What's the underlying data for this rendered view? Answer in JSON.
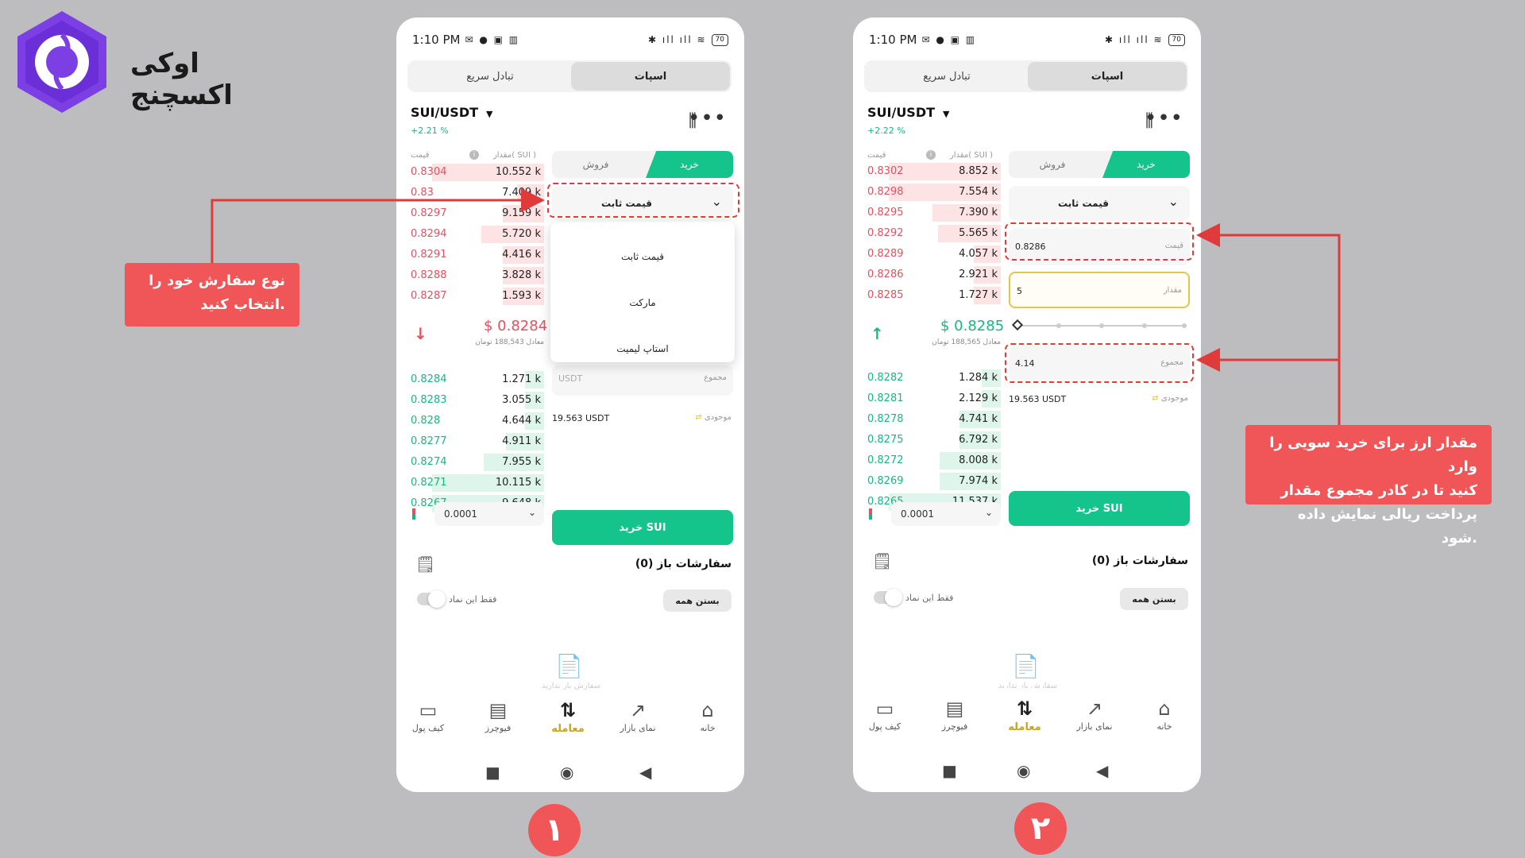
{
  "brand": {
    "name": "اوکی اکسچنج"
  },
  "phones": [
    {
      "status": {
        "time": "1:10 PM",
        "battery": "70"
      },
      "tabs": {
        "quick": "تبادل سریع",
        "spot": "اسپات"
      },
      "pair": "SUI/USDT",
      "change": "+2.21 %",
      "orderbook_header": {
        "price": "قیمت",
        "qty": "مقدار( SUI )"
      },
      "asks": [
        {
          "p": "0.8304",
          "q": "10.552 k",
          "depth": 0.82
        },
        {
          "p": "0.83",
          "q": "7.409 k",
          "depth": 0.2
        },
        {
          "p": "0.8297",
          "q": "9.159 k",
          "depth": 0.3
        },
        {
          "p": "0.8294",
          "q": "5.720 k",
          "depth": 0.46
        },
        {
          "p": "0.8291",
          "q": "4.416 k",
          "depth": 0.3
        },
        {
          "p": "0.8288",
          "q": "3.828 k",
          "depth": 0.3
        },
        {
          "p": "0.8287",
          "q": "1.593 k",
          "depth": 0.3
        }
      ],
      "last_price": "$ 0.8284",
      "trend": "down",
      "equiv": "معادل 188,543 تومان",
      "bids": [
        {
          "p": "0.8284",
          "q": "1.271 k",
          "depth": 0.14
        },
        {
          "p": "0.8283",
          "q": "3.055 k",
          "depth": 0.14
        },
        {
          "p": "0.828",
          "q": "4.644 k",
          "depth": 0.14
        },
        {
          "p": "0.8277",
          "q": "4.911 k",
          "depth": 0.28
        },
        {
          "p": "0.8274",
          "q": "7.955 k",
          "depth": 0.44
        },
        {
          "p": "0.8271",
          "q": "10.115 k",
          "depth": 0.82
        },
        {
          "p": "0.8267",
          "q": "9.648 k",
          "depth": 0.82
        }
      ],
      "tick": "0.0001",
      "side_tabs": {
        "sell": "فروش",
        "buy": "خرید"
      },
      "order_type": "قیمت ثابت",
      "dropdown": [
        "قیمت ثابت",
        "مارکت",
        "استاپ لیمیت"
      ],
      "total": {
        "value": "USDT",
        "label": "مجموع"
      },
      "balance": {
        "value": "19.563 USDT",
        "label": "موجودی"
      },
      "buy_button": "خرید SUI",
      "open_orders": "سفارشات باز (0)",
      "only_symbol": "فقط این نماد",
      "close_all": "بستن همه",
      "empty_text": "سفارش باز ندارید",
      "nav": [
        "کیف پول",
        "فیوچرز",
        "معامله",
        "نمای بازار",
        "خانه"
      ]
    },
    {
      "status": {
        "time": "1:10 PM",
        "battery": "70"
      },
      "tabs": {
        "quick": "تبادل سریع",
        "spot": "اسپات"
      },
      "pair": "SUI/USDT",
      "change": "+2.22 %",
      "orderbook_header": {
        "price": "قیمت",
        "qty": "مقدار( SUI )"
      },
      "asks": [
        {
          "p": "0.8302",
          "q": "8.852 k",
          "depth": 0.82
        },
        {
          "p": "0.8298",
          "q": "7.554 k",
          "depth": 0.82
        },
        {
          "p": "0.8295",
          "q": "7.390 k",
          "depth": 0.5
        },
        {
          "p": "0.8292",
          "q": "5.565 k",
          "depth": 0.46
        },
        {
          "p": "0.8289",
          "q": "4.057 k",
          "depth": 0.2
        },
        {
          "p": "0.8286",
          "q": "2.921 k",
          "depth": 0.2
        },
        {
          "p": "0.8285",
          "q": "1.727 k",
          "depth": 0.2
        }
      ],
      "last_price": "$ 0.8285",
      "trend": "up",
      "equiv": "معادل 188,565 تومان",
      "bids": [
        {
          "p": "0.8282",
          "q": "1.284 k",
          "depth": 0.14
        },
        {
          "p": "0.8281",
          "q": "2.129 k",
          "depth": 0.14
        },
        {
          "p": "0.8278",
          "q": "4.741 k",
          "depth": 0.3
        },
        {
          "p": "0.8275",
          "q": "6.792 k",
          "depth": 0.3
        },
        {
          "p": "0.8272",
          "q": "8.008 k",
          "depth": 0.45
        },
        {
          "p": "0.8269",
          "q": "7.974 k",
          "depth": 0.45
        },
        {
          "p": "0.8265",
          "q": "11.537 k",
          "depth": 0.82
        }
      ],
      "tick": "0.0001",
      "side_tabs": {
        "sell": "فروش",
        "buy": "خرید"
      },
      "order_type": "قیمت ثابت",
      "price_field": {
        "value": "0.8286",
        "label": "قیمت"
      },
      "amount_field": {
        "value": "5",
        "label": "مقدار"
      },
      "total": {
        "value": "4.14",
        "label": "مجموع"
      },
      "balance": {
        "value": "19.563 USDT",
        "label": "موجودی"
      },
      "buy_button": "خرید SUI",
      "open_orders": "سفارشات باز (0)",
      "only_symbol": "فقط این نماد",
      "close_all": "بستن همه",
      "empty_text": "سفارش باز ندارید",
      "nav": [
        "کیف پول",
        "فیوچرز",
        "معامله",
        "نمای بازار",
        "خانه"
      ]
    }
  ],
  "callouts": {
    "step1": [
      "نوع سفارش خود را",
      "انتخاب کنید."
    ],
    "step2": [
      "مقدار ارز برای خرید سویی را وارد",
      "کنید تا در کادر مجموع مقدار",
      "پرداخت ریالی نمایش داده شود."
    ]
  },
  "steps": [
    "۱",
    "۲"
  ],
  "colors": {
    "buy": "#14c48a",
    "sell": "#e2515f",
    "callout": "#f05657",
    "active_nav": "#c9a321"
  }
}
